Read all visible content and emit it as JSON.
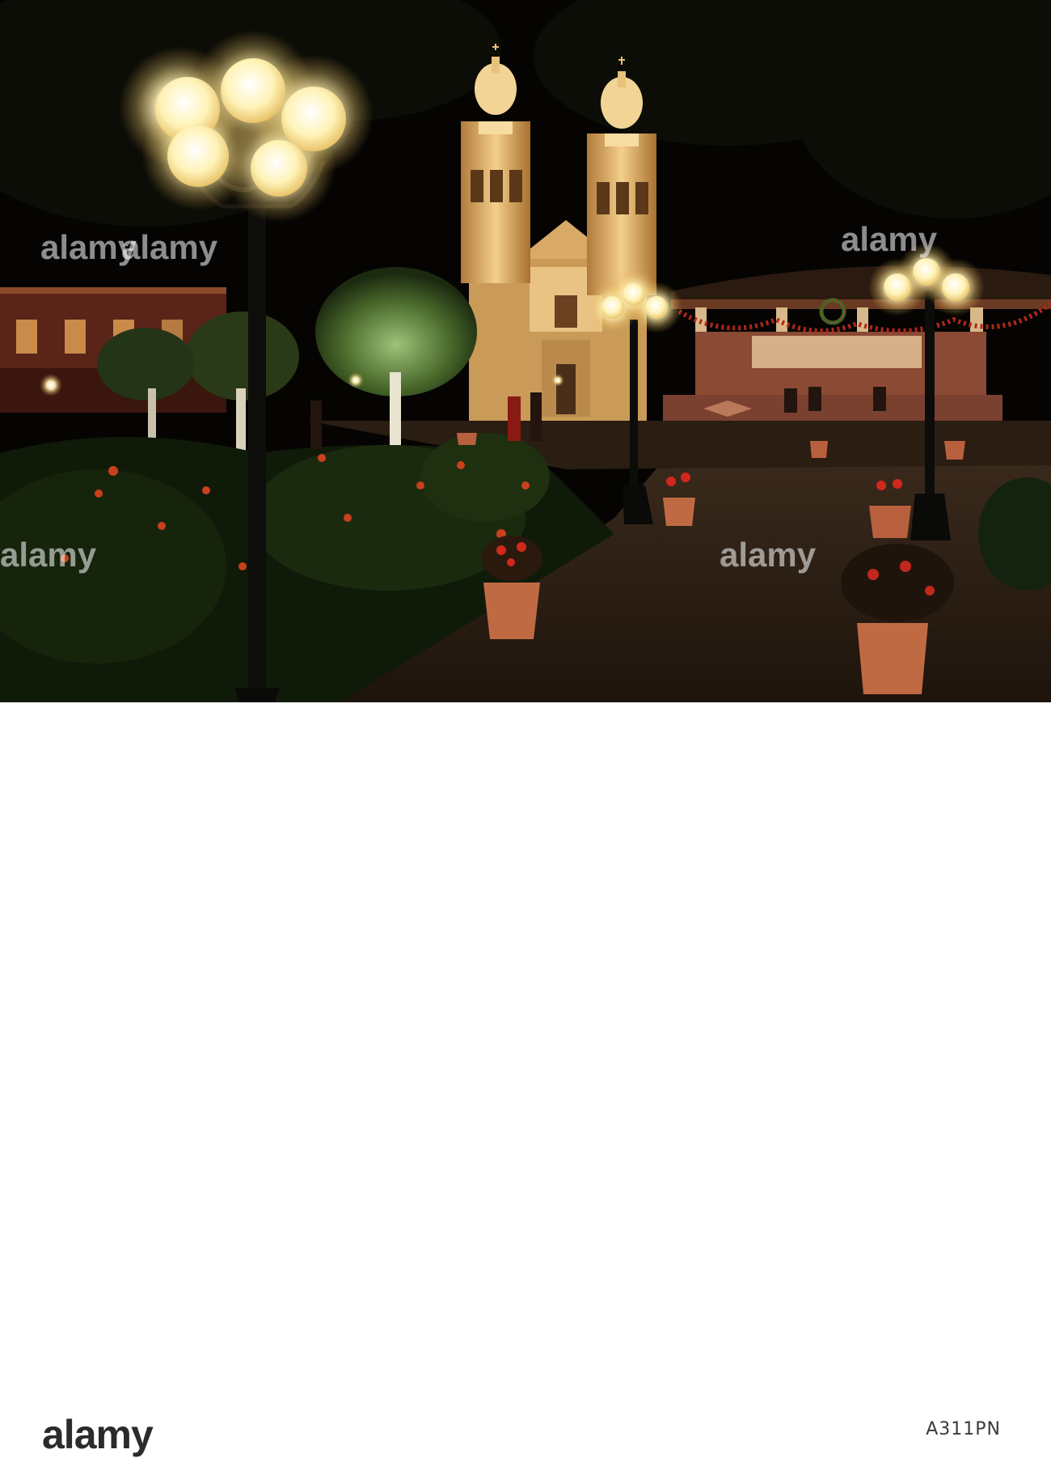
{
  "photo": {
    "subject": "night-lit cathedral plaza",
    "watermark_text": "alamy"
  },
  "footer": {
    "brand": "alamy",
    "image_id": "A311PN"
  },
  "colors": {
    "sky": "#040302",
    "cathedral": "#e8b868",
    "lamp_glow": "#fff6c8",
    "foliage": "#1a2a10",
    "pavement": "#2b1d12",
    "footer_bg": "#ffffff"
  }
}
